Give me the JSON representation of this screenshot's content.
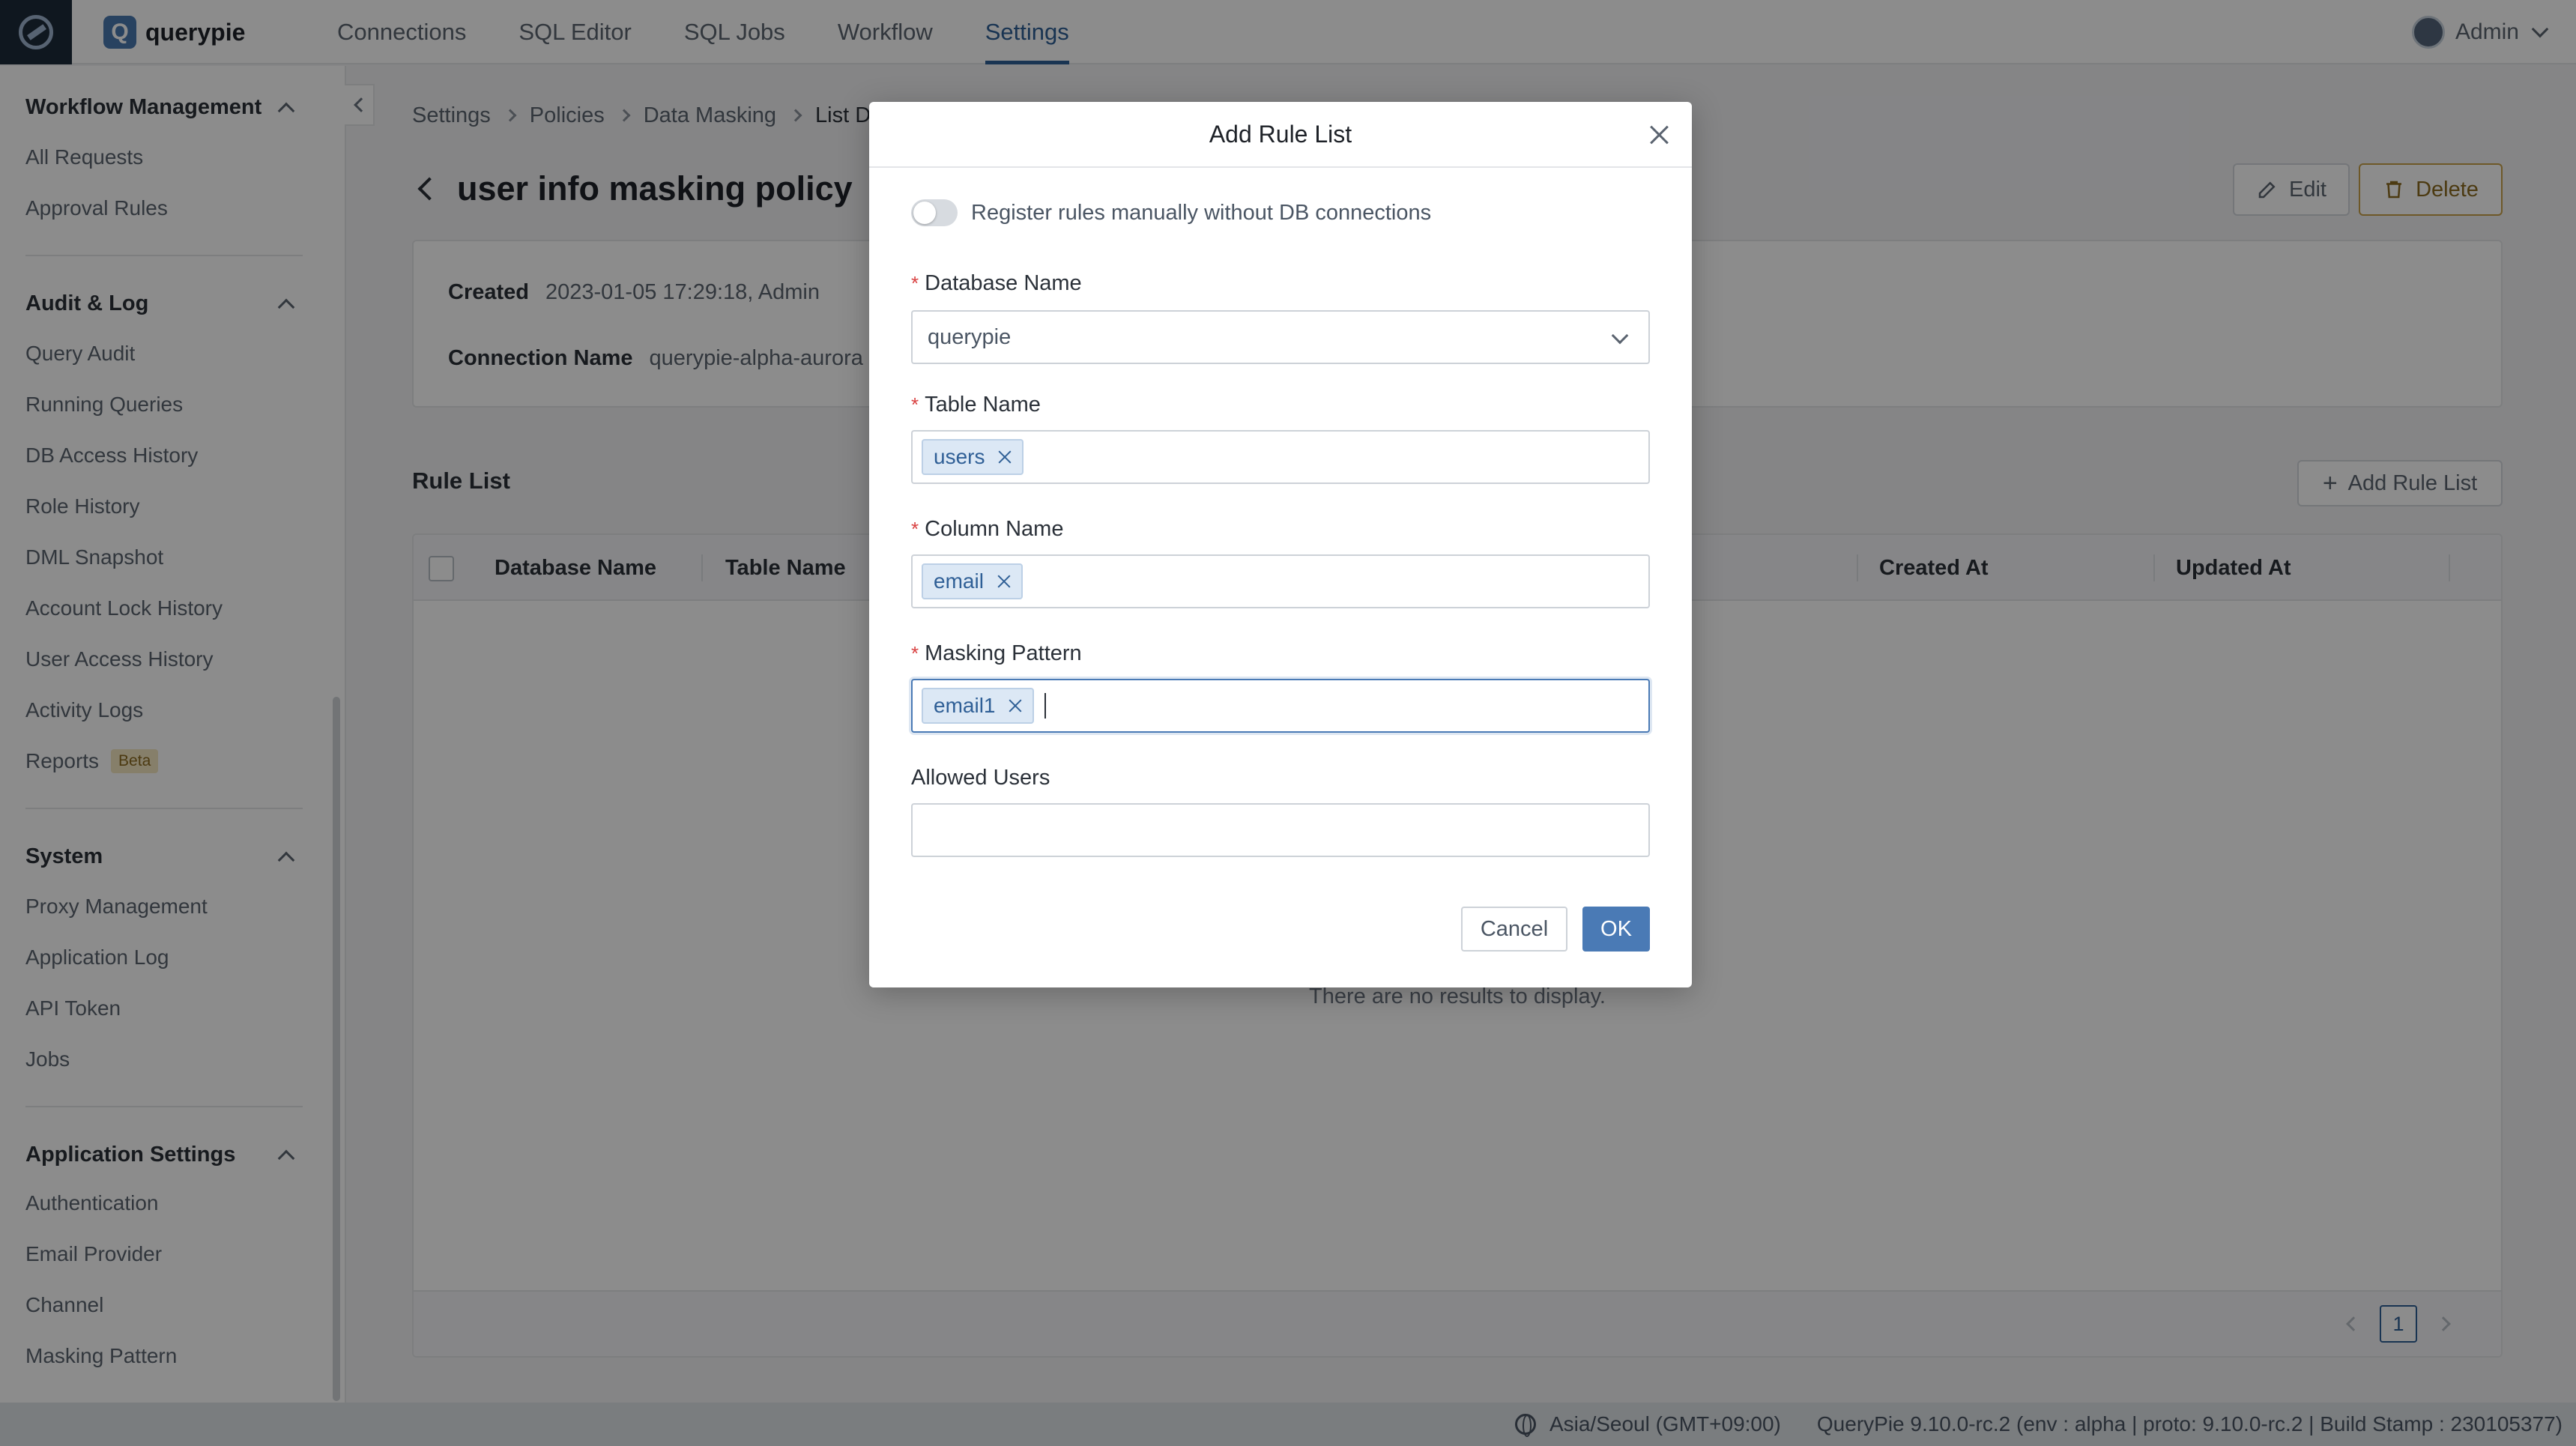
{
  "app": {
    "brand": "querypie",
    "logo_letter": "Q",
    "user": "Admin"
  },
  "nav": [
    "Connections",
    "SQL Editor",
    "SQL Jobs",
    "Workflow",
    "Settings"
  ],
  "nav_active": "Settings",
  "sidebar": {
    "groups": [
      {
        "title": "Workflow Management",
        "items": [
          "All Requests",
          "Approval Rules"
        ]
      },
      {
        "title": "Audit & Log",
        "items": [
          "Query Audit",
          "Running Queries",
          "DB Access History",
          "Role History",
          "DML Snapshot",
          "Account Lock History",
          "User Access History",
          "Activity Logs",
          "Reports"
        ]
      },
      {
        "title": "System",
        "items": [
          "Proxy Management",
          "Application Log",
          "API Token",
          "Jobs"
        ]
      },
      {
        "title": "Application Settings",
        "items": [
          "Authentication",
          "Email Provider",
          "Channel",
          "Masking Pattern"
        ]
      }
    ],
    "beta_badge": "Beta"
  },
  "breadcrumb": [
    "Settings",
    "Policies",
    "Data Masking",
    "List D"
  ],
  "page": {
    "title": "user info masking policy",
    "edit_label": "Edit",
    "delete_label": "Delete",
    "created_label": "Created",
    "created_value": "2023-01-05 17:29:18, Admin",
    "connection_label": "Connection Name",
    "connection_value": "querypie-alpha-aurora"
  },
  "rule_list": {
    "title": "Rule List",
    "add_label": "Add Rule List",
    "columns": [
      "Database Name",
      "Table Name",
      "Created At",
      "Updated At"
    ],
    "empty_text": "There are no results to display.",
    "page": "1"
  },
  "statusbar": {
    "timezone": "Asia/Seoul (GMT+09:00)",
    "build": "QueryPie 9.10.0-rc.2 (env : alpha | proto: 9.10.0-rc.2 | Build Stamp : 230105377)"
  },
  "modal": {
    "title": "Add Rule List",
    "toggle_label": "Register rules manually without DB connections",
    "db_label": "Database Name",
    "db_value": "querypie",
    "table_label": "Table Name",
    "table_tags": [
      "users"
    ],
    "column_label": "Column Name",
    "column_tags": [
      "email"
    ],
    "pattern_label": "Masking Pattern",
    "pattern_tags": [
      "email1"
    ],
    "allowed_label": "Allowed Users",
    "cancel_label": "Cancel",
    "ok_label": "OK"
  }
}
